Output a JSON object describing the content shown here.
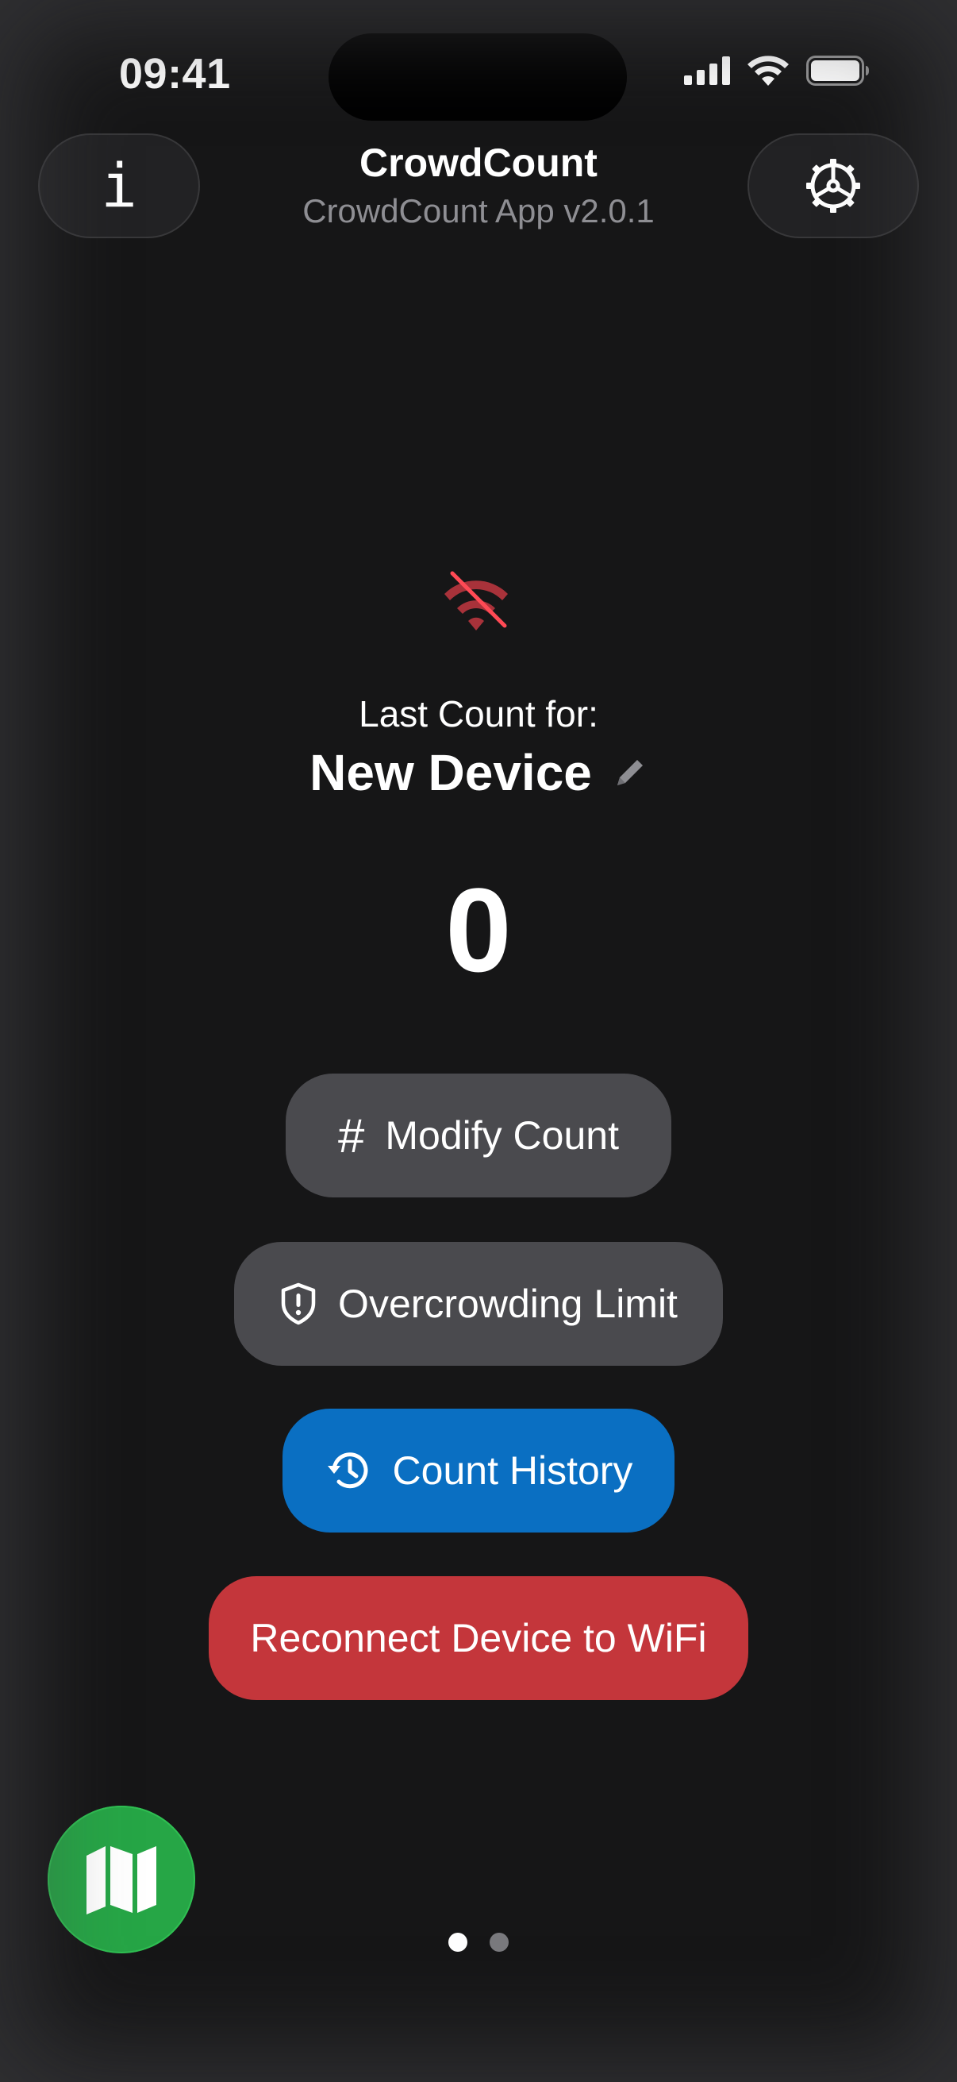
{
  "status_bar": {
    "time": "09:41"
  },
  "header": {
    "title": "CrowdCount",
    "subtitle": "CrowdCount App v2.0.1",
    "info_icon_glyph": "i",
    "info_icon": "info-icon",
    "settings_icon": "gear-icon"
  },
  "main": {
    "connection_icon": "wifi-slash-icon",
    "last_count_label": "Last Count for:",
    "device_name": "New Device",
    "edit_icon": "pencil-icon",
    "count": "0"
  },
  "actions": {
    "modify_count": {
      "label": "Modify Count",
      "icon_glyph": "#",
      "icon": "hash-icon"
    },
    "overcrowding_limit": {
      "label": "Overcrowding Limit",
      "icon": "shield-exclamation-icon"
    },
    "count_history": {
      "label": "Count History",
      "icon": "clock-history-icon"
    },
    "reconnect_wifi": {
      "label": "Reconnect Device to WiFi"
    }
  },
  "bottom": {
    "map_icon": "map-icon",
    "pages": 2,
    "active_page": 1
  },
  "colors": {
    "background": "#161617",
    "secondary_button": "#4a4a4e",
    "primary_button": "#0a6fc2",
    "danger_button": "#c4363b",
    "map_button": "#26a646",
    "wifi_off": "#c4363b"
  }
}
